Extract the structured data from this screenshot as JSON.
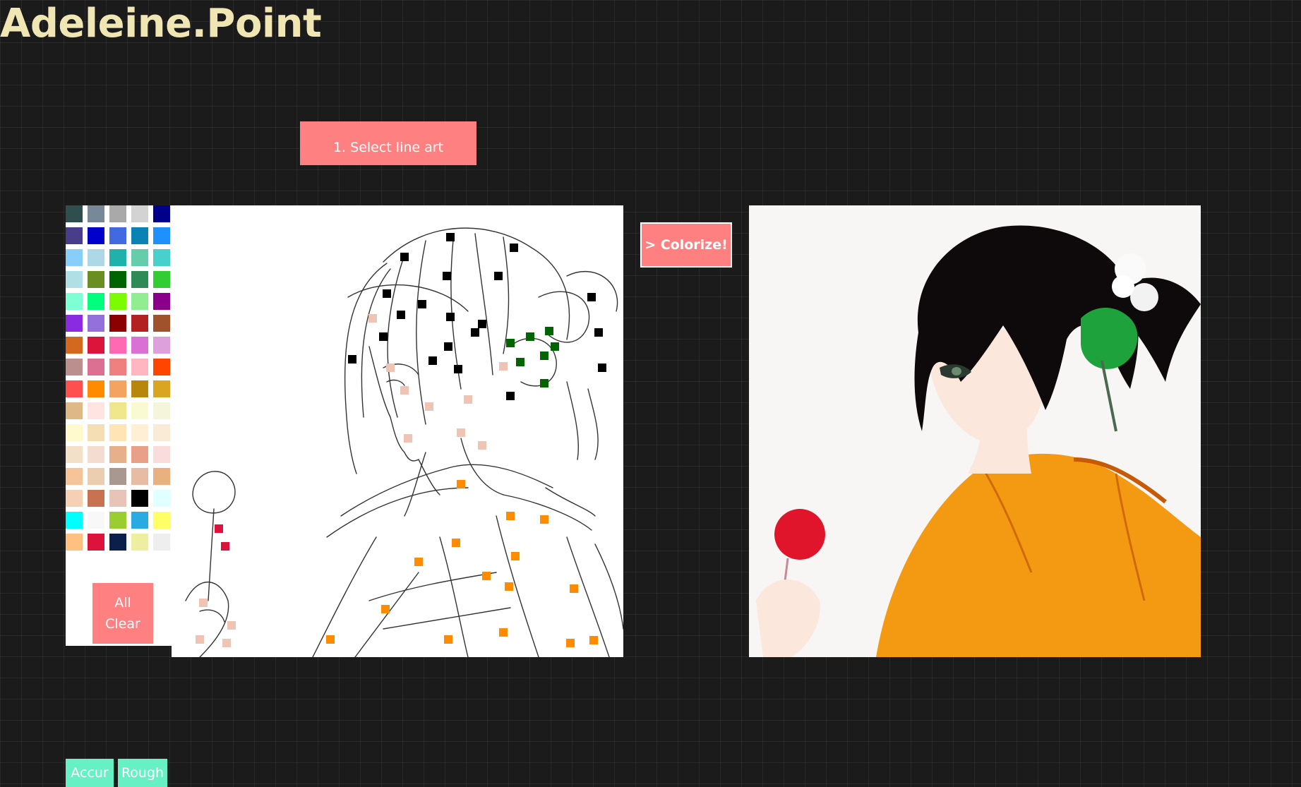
{
  "app": {
    "title": "Adeleine.Point"
  },
  "toolbar": {
    "select_label": "1. Select line art",
    "colorize_label": "> Colorize!",
    "accurate_label": "Accur",
    "rough_label": "Rough",
    "clear_line1": "All",
    "clear_line2": "Clear"
  },
  "palette": {
    "colors": [
      "#2f4f4f",
      "#778899",
      "#a9a9a9",
      "#d3d3d3",
      "#00008b",
      "#483d8b",
      "#0000cd",
      "#4169e1",
      "#0a82b4",
      "#1e90ff",
      "#87cefa",
      "#add8e6",
      "#20b2aa",
      "#66cdaa",
      "#48d1cc",
      "#b0e0e6",
      "#6b8e23",
      "#006400",
      "#2e8b57",
      "#32cd32",
      "#7fffd4",
      "#00ff7f",
      "#7cfc00",
      "#90ee90",
      "#8b008b",
      "#8a2be2",
      "#9370db",
      "#8b0000",
      "#b22222",
      "#a0522d",
      "#d2691e",
      "#dc143c",
      "#ff69b4",
      "#da70d6",
      "#dda0dd",
      "#bc8f8f",
      "#db7093",
      "#f08080",
      "#ffb6c1",
      "#ff4500",
      "#ff4f4f",
      "#ff8c00",
      "#f4a460",
      "#b8860b",
      "#daa520",
      "#deb887",
      "#ffe4e1",
      "#f0e68c",
      "#fafad2",
      "#f5f5dc",
      "#fffacd",
      "#f5deb3",
      "#ffe4b5",
      "#ffefd5",
      "#faebd7",
      "#f2e0c8",
      "#f5dcd0",
      "#e8b08a",
      "#e8a088",
      "#fbdcdc",
      "#f7c49a",
      "#ebcdb0",
      "#a89890",
      "#e6bca4",
      "#e9b080",
      "#f5d0b4",
      "#c87250",
      "#e8c4b8",
      "#000000",
      "#e0ffff",
      "#00ffff",
      "#f8f8f8",
      "#9acd32",
      "#29abe2",
      "#ffff66",
      "#ffc080",
      "#dc143c",
      "#0b1f4a",
      "#eeeea0",
      "#eeeeee"
    ]
  },
  "hints": {
    "black_color": "#000000",
    "skin_color": "#efc4b4",
    "green_color": "#006400",
    "orange_color": "#ff8c00",
    "red_color": "#dc143c"
  },
  "result": {
    "hair_color": "#0e0a0c",
    "kimono_color": "#f49a12",
    "skin_color": "#fbe7db",
    "ornament_color": "#1ea33c",
    "candy_color": "#e0142a",
    "background_color": "#f7f6f4"
  }
}
